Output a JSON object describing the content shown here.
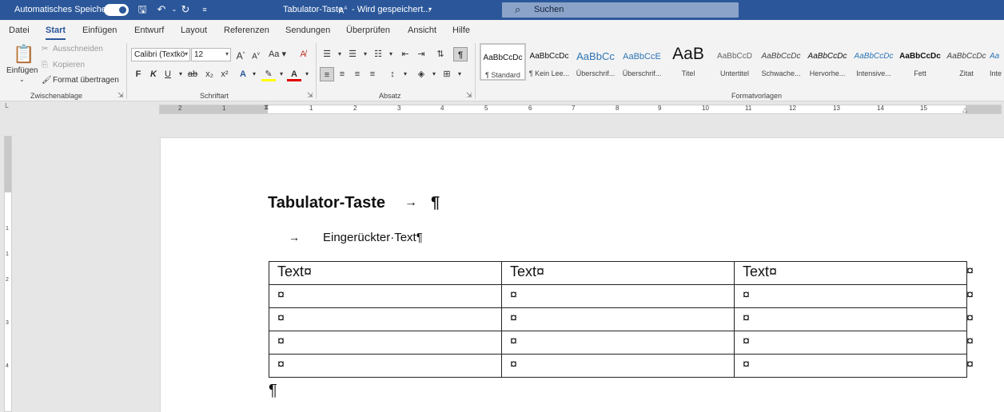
{
  "titlebar": {
    "autosave_label": "Automatisches Speichern",
    "autosave_state": "on",
    "doc_title": "Tabulator-Taste",
    "saving_status": "- Wird gespeichert...",
    "search_placeholder": "Suchen"
  },
  "tabs": [
    "Datei",
    "Start",
    "Einfügen",
    "Entwurf",
    "Layout",
    "Referenzen",
    "Sendungen",
    "Überprüfen",
    "Ansicht",
    "Hilfe"
  ],
  "active_tab": "Start",
  "ribbon": {
    "clipboard": {
      "paste": "Einfügen",
      "cut": "Ausschneiden",
      "copy": "Kopieren",
      "format_painter": "Format übertragen",
      "group": "Zwischenablage"
    },
    "font": {
      "font_name": "Calibri (Textkö",
      "font_size": "12",
      "bold": "F",
      "italic": "K",
      "underline": "U",
      "strike": "ab",
      "sub": "x₂",
      "sup": "x²",
      "case": "Aa",
      "grow": "A",
      "shrink": "A",
      "group": "Schriftart"
    },
    "paragraph": {
      "group": "Absatz",
      "pilcrow": "¶"
    },
    "styles": {
      "group": "Formatvorlagen",
      "items": [
        {
          "preview": "AaBbCcDc",
          "name": "¶ Standard"
        },
        {
          "preview": "AaBbCcDc",
          "name": "¶ Kein Lee..."
        },
        {
          "preview": "AaBbCc",
          "name": "Überschrif..."
        },
        {
          "preview": "AaBbCcE",
          "name": "Überschrif..."
        },
        {
          "preview": "AaB",
          "name": "Titel"
        },
        {
          "preview": "AaBbCcD",
          "name": "Untertitel"
        },
        {
          "preview": "AaBbCcDc",
          "name": "Schwache..."
        },
        {
          "preview": "AaBbCcDc",
          "name": "Hervorhe..."
        },
        {
          "preview": "AaBbCcDc",
          "name": "Intensive..."
        },
        {
          "preview": "AaBbCcDc",
          "name": "Fett"
        },
        {
          "preview": "AaBbCcDc",
          "name": "Zitat"
        },
        {
          "preview": "Aa",
          "name": "Inte"
        }
      ]
    }
  },
  "ruler": {
    "numbers": [
      "2",
      "1",
      "1",
      "2",
      "3",
      "4",
      "5",
      "6",
      "7",
      "8",
      "9",
      "10",
      "11",
      "12",
      "13",
      "14",
      "15"
    ],
    "vnumbers": [
      "1",
      "1",
      "2",
      "3",
      "4"
    ]
  },
  "document": {
    "heading": "Tabulator-Taste",
    "tab_arrow": "→",
    "heading_pilcrow": "¶",
    "indented_text": "Eingerückter·Text¶",
    "table": [
      [
        "Text¤",
        "Text¤",
        "Text¤"
      ],
      [
        "¤",
        "¤",
        "¤"
      ],
      [
        "¤",
        "¤",
        "¤"
      ],
      [
        "¤",
        "¤",
        "¤"
      ],
      [
        "¤",
        "¤",
        "¤"
      ]
    ],
    "row_end_mark": "¤",
    "end_pilcrow": "¶"
  },
  "colors": {
    "titlebar": "#2b579a",
    "ribbon": "#f3f3f3",
    "highlight": "#ffff00",
    "font_color": "#e00000"
  }
}
